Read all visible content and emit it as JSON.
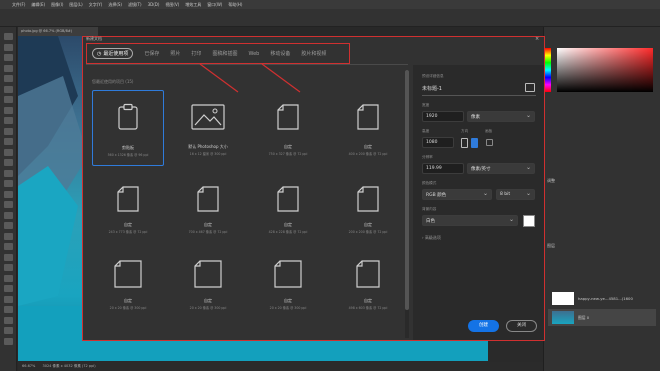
{
  "menubar": {
    "items": [
      "文件(F)",
      "编辑(E)",
      "图像(I)",
      "图层(L)",
      "文字(Y)",
      "选择(S)",
      "滤镜(T)",
      "3D(D)",
      "视图(V)",
      "增效工具",
      "窗口(W)",
      "帮助(H)"
    ]
  },
  "document": {
    "tab_label": "photo.jpg @ 66.7% (RGB/8#)",
    "zoom": "66.67%",
    "status": "3024 像素 x 4032 像素 (72 ppi)"
  },
  "dialog": {
    "title": "新建文档",
    "close_glyph": "×",
    "tabs": [
      {
        "label": "最近使用项",
        "active": true
      },
      {
        "label": "已保存"
      },
      {
        "label": "照片"
      },
      {
        "label": "打印"
      },
      {
        "label": "图稿和插图"
      },
      {
        "label": "Web"
      },
      {
        "label": "移动设备"
      },
      {
        "label": "胶片和视频"
      }
    ],
    "recent_label": "您最近使用的项目 (15)",
    "items": [
      {
        "name": "剪贴板",
        "size": "560 x 1326 像素 @ 96 ppi",
        "icon": "clipboard-icon",
        "selected": true
      },
      {
        "name": "默认 Photoshop 大小",
        "size": "16 x 12 厘米 @ 300 ppi",
        "icon": "image-icon"
      },
      {
        "name": "自定",
        "size": "750 x 327 像素 @ 72 ppi",
        "icon": "document-icon"
      },
      {
        "name": "自定",
        "size": "400 x 200 像素 @ 72 ppi",
        "icon": "document-icon"
      },
      {
        "name": "自定",
        "size": "243 x 773 像素 @ 72 ppi",
        "icon": "document-icon"
      },
      {
        "name": "自定",
        "size": "700 x 467 像素 @ 72 ppi",
        "icon": "document-icon"
      },
      {
        "name": "自定",
        "size": "428 x 228 像素 @ 72 ppi",
        "icon": "document-icon"
      },
      {
        "name": "自定",
        "size": "200 x 200 像素 @ 72 ppi",
        "icon": "document-icon"
      },
      {
        "name": "自定",
        "size": "20 x 20 像素 @ 300 ppi",
        "icon": "document-icon"
      },
      {
        "name": "自定",
        "size": "20 x 20 像素 @ 300 ppi",
        "icon": "document-icon"
      },
      {
        "name": "自定",
        "size": "20 x 20 像素 @ 300 ppi",
        "icon": "document-icon"
      },
      {
        "name": "自定",
        "size": "498 x 603 像素 @ 72 ppi",
        "icon": "document-icon"
      }
    ],
    "details": {
      "section_label": "预设详细信息",
      "preset_name": "未标题-1",
      "width_label": "宽度",
      "width_value": "1920",
      "width_unit": "像素",
      "height_label": "高度",
      "height_value": "1080",
      "orientation_label": "方向",
      "artboard_label": "画板",
      "resolution_label": "分辨率",
      "resolution_value": "119.99",
      "resolution_unit": "像素/英寸",
      "color_mode_label": "颜色模式",
      "color_mode_value": "RGB 颜色",
      "bit_depth": "8 bit",
      "bg_label": "背景内容",
      "bg_value": "白色",
      "advanced_label": "高级选项"
    },
    "create_label": "创建",
    "close_label": "关闭"
  },
  "panels": {
    "adjust_label": "调整",
    "layers_label": "图层",
    "layer1_name": "happy-new-ye...4581...(1600",
    "layer2_name": "图层 0"
  },
  "colors": {
    "annotation": "#d03030",
    "accent_blue": "#1473e6"
  }
}
